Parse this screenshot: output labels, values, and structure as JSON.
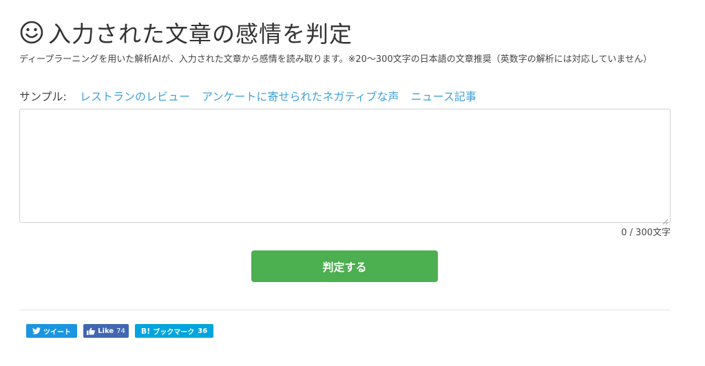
{
  "header": {
    "title": "入力された文章の感情を判定",
    "icon": "smiley-face-icon"
  },
  "description": "ディープラーニングを用いた解析AIが、入力された文章から感情を読み取ります。※20〜300文字の日本語の文章推奨（英数字の解析には対応していません）",
  "samples": {
    "label": "サンプル:",
    "links": [
      "レストランのレビュー",
      "アンケートに寄せられたネガティブな声",
      "ニュース記事"
    ],
    "link_color": "#3fa0da"
  },
  "input": {
    "value": "",
    "placeholder": ""
  },
  "counter": "0 / 300文字",
  "submit": {
    "label": "判定する",
    "color": "#4caf50"
  },
  "share": {
    "tweet_label": "ツイート",
    "like_label": "Like",
    "like_count": "74",
    "hatena_prefix": "B!",
    "hatena_label": "ブックマーク",
    "hatena_count": "36",
    "colors": {
      "tweet": "#1b95e0",
      "like": "#4267b2",
      "hatena": "#00a4de"
    }
  }
}
